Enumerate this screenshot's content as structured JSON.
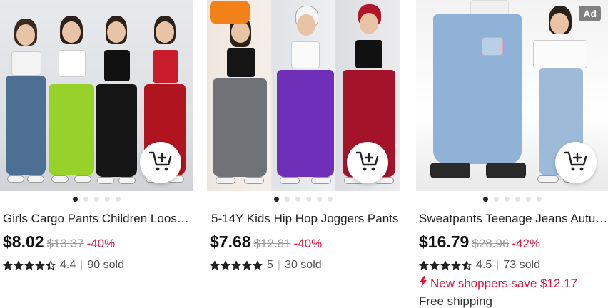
{
  "products": [
    {
      "title": "Girls Cargo Pants Children Loose Hip Hop",
      "price": "$8.02",
      "original_price": "$13.37",
      "discount": "-40%",
      "rating": "4.4",
      "stars": 4.4,
      "sold": "90 sold",
      "dots_total": 5,
      "dots_active": 0,
      "image_desc": "four-girls-cargo-pants"
    },
    {
      "title": "5-14Y Kids Hip Hop Joggers Pants",
      "price": "$7.68",
      "original_price": "$12.81",
      "discount": "-40%",
      "rating": "5",
      "stars": 5,
      "sold": "30 sold",
      "dots_total": 6,
      "dots_active": 0,
      "image_desc": "three-girls-joggers"
    },
    {
      "title": "Sweatpants Teenage Jeans Autumn",
      "price": "$16.79",
      "original_price": "$28.96",
      "discount": "-42%",
      "rating": "4.5",
      "stars": 4.5,
      "sold": "73 sold",
      "promo": "New shoppers save $12.17",
      "shipping": "Free shipping",
      "ad_label": "Ad",
      "dots_total": 6,
      "dots_active": 0,
      "image_desc": "girl-wide-leg-jeans"
    }
  ],
  "colors": {
    "accent_red": "#e0193f",
    "text": "#222222",
    "muted": "#999999",
    "badge_orange": "#f28218"
  },
  "icons": {
    "cart": "add-to-cart-icon",
    "star": "star-icon",
    "promo": "flash-tag-icon"
  }
}
